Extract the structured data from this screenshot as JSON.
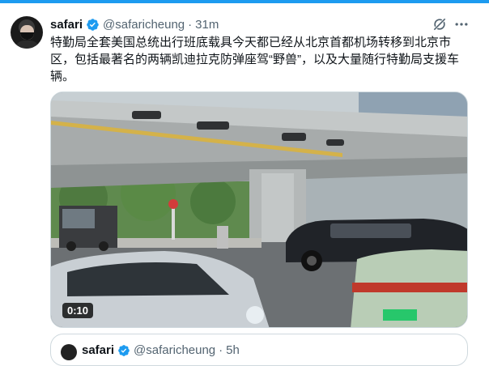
{
  "colors": {
    "accent": "#1d9bf0",
    "text": "#0f1419",
    "muted": "#536471",
    "border": "#cfd9de"
  },
  "tweet": {
    "author_name": "safari",
    "handle": "@safaricheung",
    "separator": "·",
    "time": "31m",
    "text": "特勤局全套美国总统出行班底载具今天都已经从北京首都机场转移到北京市区，包括最著名的两辆凯迪拉克防弹座驾“野兽”，以及大量随行特勤局支援车辆。",
    "icons": [
      "verified-badge-icon",
      "grok-icon",
      "more-icon"
    ]
  },
  "media": {
    "type": "video",
    "duration": "0:10"
  },
  "quoted_tweet": {
    "author_name": "safari",
    "handle": "@safaricheung",
    "separator": "·",
    "time": "5h"
  }
}
